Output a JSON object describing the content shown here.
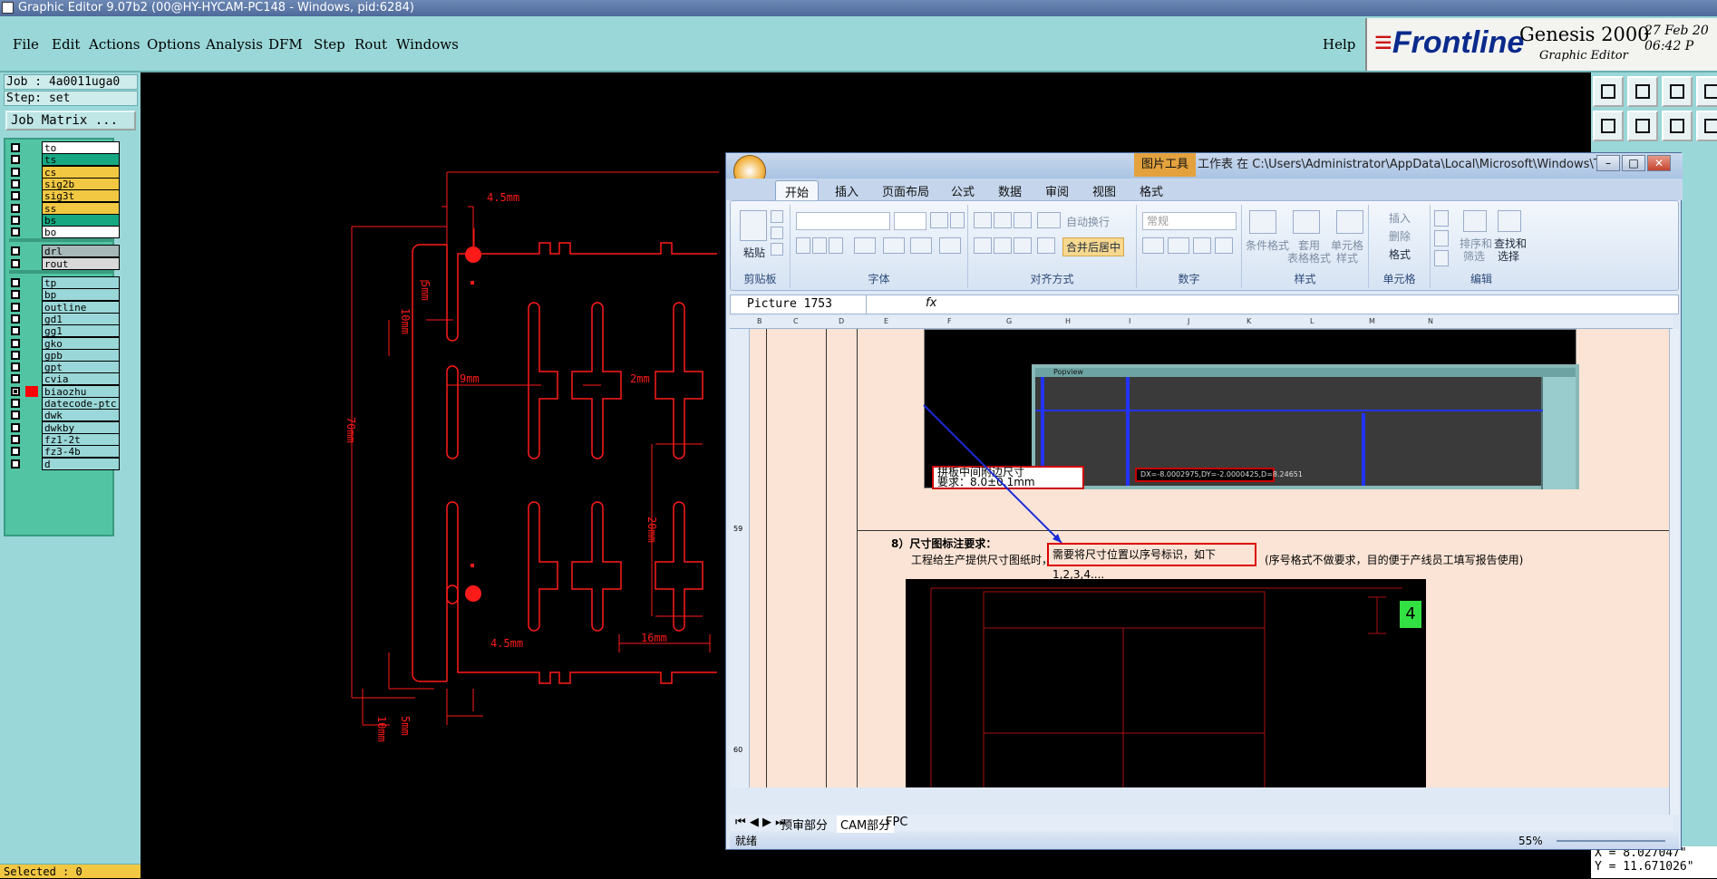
{
  "window": {
    "title": "Graphic Editor 9.07b2 (00@HY-HYCAM-PC148 - Windows, pid:6284)"
  },
  "menu": {
    "items": [
      "File",
      "Edit",
      "Actions",
      "Options",
      "Analysis",
      "DFM",
      "Step",
      "Rout",
      "Windows"
    ],
    "help": "Help"
  },
  "brand": {
    "logo": "Frontline",
    "product": "Genesis 2000",
    "module": "Graphic Editor",
    "date": "27 Feb 20",
    "time": "06:42 P"
  },
  "job": {
    "job_line": "Job : 4a0011uga0",
    "step_line": "Step: set",
    "matrix_button": "Job Matrix ..."
  },
  "layers": [
    {
      "name": "to",
      "color": "#ffffff",
      "checked": false
    },
    {
      "name": "ts",
      "color": "#17a882",
      "checked": false
    },
    {
      "name": "cs",
      "color": "#f2c843",
      "checked": false
    },
    {
      "name": "sig2b",
      "color": "#f2c843",
      "checked": false
    },
    {
      "name": "sig3t",
      "color": "#f2c843",
      "checked": false
    },
    {
      "name": "ss",
      "color": "#f2c843",
      "checked": false
    },
    {
      "name": "bs",
      "color": "#17a882",
      "checked": false
    },
    {
      "name": "bo",
      "color": "#ffffff",
      "checked": false
    },
    {
      "name": "drl",
      "color": "#a7b8b8",
      "checked": false
    },
    {
      "name": "rout",
      "color": "#d9d9d9",
      "checked": false
    },
    {
      "name": "tp",
      "color": "#9ad7d8",
      "checked": false
    },
    {
      "name": "bp",
      "color": "#9ad7d8",
      "checked": false
    },
    {
      "name": "outline",
      "color": "#9ad7d8",
      "checked": false
    },
    {
      "name": "gd1",
      "color": "#9ad7d8",
      "checked": false
    },
    {
      "name": "gg1",
      "color": "#9ad7d8",
      "checked": false
    },
    {
      "name": "gko",
      "color": "#9ad7d8",
      "checked": false
    },
    {
      "name": "gpb",
      "color": "#9ad7d8",
      "checked": false
    },
    {
      "name": "gpt",
      "color": "#9ad7d8",
      "checked": false
    },
    {
      "name": "cvia",
      "color": "#9ad7d8",
      "checked": false
    },
    {
      "name": "biaozhu",
      "color": "#9ad7d8",
      "checked": true,
      "swatch": "#ff0000"
    },
    {
      "name": "datecode-ptc",
      "color": "#9ad7d8",
      "checked": false
    },
    {
      "name": "dwk",
      "color": "#9ad7d8",
      "checked": false
    },
    {
      "name": "dwkby",
      "color": "#9ad7d8",
      "checked": false
    },
    {
      "name": "fz1-2t",
      "color": "#9ad7d8",
      "checked": false
    },
    {
      "name": "fz3-4b",
      "color": "#9ad7d8",
      "checked": false
    },
    {
      "name": "d",
      "color": "#9ad7d8",
      "checked": false
    }
  ],
  "status": {
    "selected": "Selected : 0"
  },
  "coords": {
    "x": "X = 8.027047\"",
    "y": "Y = 11.671026\""
  },
  "drawing": {
    "color": "#ff1a1a",
    "dims": {
      "d1": "4.5mm",
      "d2": "5mm",
      "d3": "10mm",
      "d4": "70mm",
      "d5": "9mm",
      "d6": "2mm",
      "d7": "20mm",
      "d8": "16mm",
      "d9": "4.5mm",
      "d10": "5mm",
      "d11": "10mm"
    }
  },
  "excel": {
    "context_tab": "图片工具",
    "window_title": "工作表 在 C:\\Users\\Administrator\\AppData\\Local\\Microsoft\\Windows\\Te...",
    "tabs": [
      "开始",
      "插入",
      "页面布局",
      "公式",
      "数据",
      "审阅",
      "视图",
      "格式"
    ],
    "groups": {
      "clipboard": {
        "label": "剪贴板",
        "paste": "粘贴"
      },
      "font": {
        "label": "字体"
      },
      "align": {
        "label": "对齐方式",
        "wrap": "自动换行",
        "merge": "合并后居中"
      },
      "number": {
        "label": "数字",
        "format": "常规"
      },
      "styles": {
        "label": "样式",
        "cond": "条件格式",
        "table1": "套用",
        "table2": "表格格式",
        "cell1": "单元格",
        "cell2": "样式"
      },
      "cells": {
        "label": "单元格",
        "insert": "插入",
        "delete": "删除",
        "format": "格式"
      },
      "edit": {
        "label": "编辑",
        "sort1": "排序和",
        "sort2": "筛选",
        "find1": "查找和",
        "find2": "选择"
      }
    },
    "name_box": "Picture 1753",
    "fx": "fx",
    "rows": [
      "59",
      "60"
    ],
    "content": {
      "label1": "拼板中间附边尺寸\n要求：8.0±0.1mm",
      "label2": "DX=-8.0002975,DY=-2.0000425,D=8.24651",
      "section": "8）尺寸图标注要求：",
      "req_prefix": "工程给生产提供尺寸图纸时，",
      "req_box": "需要将尺寸位置以序号标识，如下1,2,3,4....",
      "req_suffix": "(序号格式不做要求，目的便于产线员工填写报告使用)",
      "badge": "4"
    },
    "sheets": [
      "预审部分",
      "CAM部分",
      "FPC"
    ],
    "status_left": "就绪",
    "zoom": "55%"
  }
}
